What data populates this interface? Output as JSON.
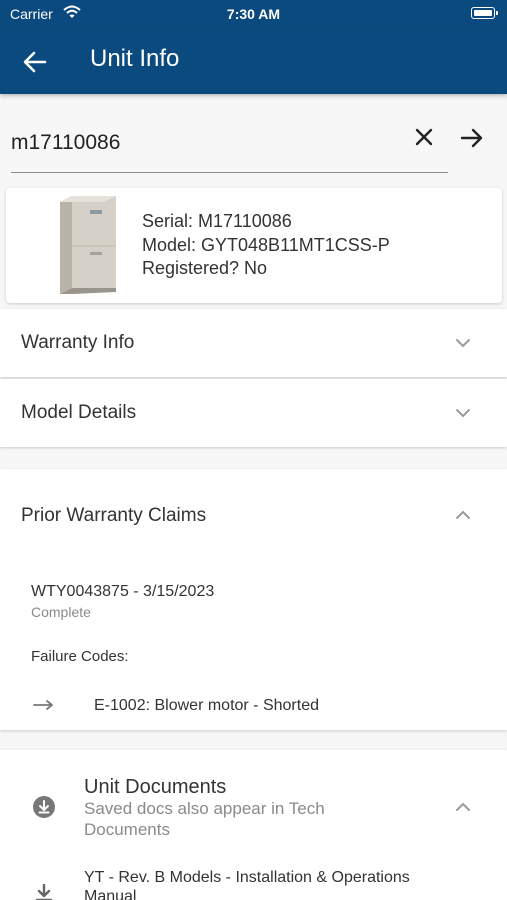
{
  "status_bar": {
    "carrier": "Carrier",
    "time": "7:30 AM"
  },
  "app_bar": {
    "title": "Unit Info"
  },
  "search": {
    "value": "m17110086"
  },
  "unit": {
    "serial": "Serial: M17110086",
    "model": "Model: GYT048B11MT1CSS-P",
    "registered": "Registered? No"
  },
  "sections": {
    "warranty_info": "Warranty Info",
    "model_details": "Model Details",
    "prior_claims": "Prior Warranty Claims"
  },
  "claims": [
    {
      "id_date": "WTY0043875 - 3/15/2023",
      "status": "Complete",
      "failure_codes_label": "Failure Codes:",
      "failure_code": "E-1002: Blower motor -  Shorted"
    }
  ],
  "documents": {
    "title": "Unit Documents",
    "subtitle": "Saved docs also appear in Tech Documents",
    "items": [
      "YT - Rev. B Models - Installation & Operations Manual"
    ]
  }
}
